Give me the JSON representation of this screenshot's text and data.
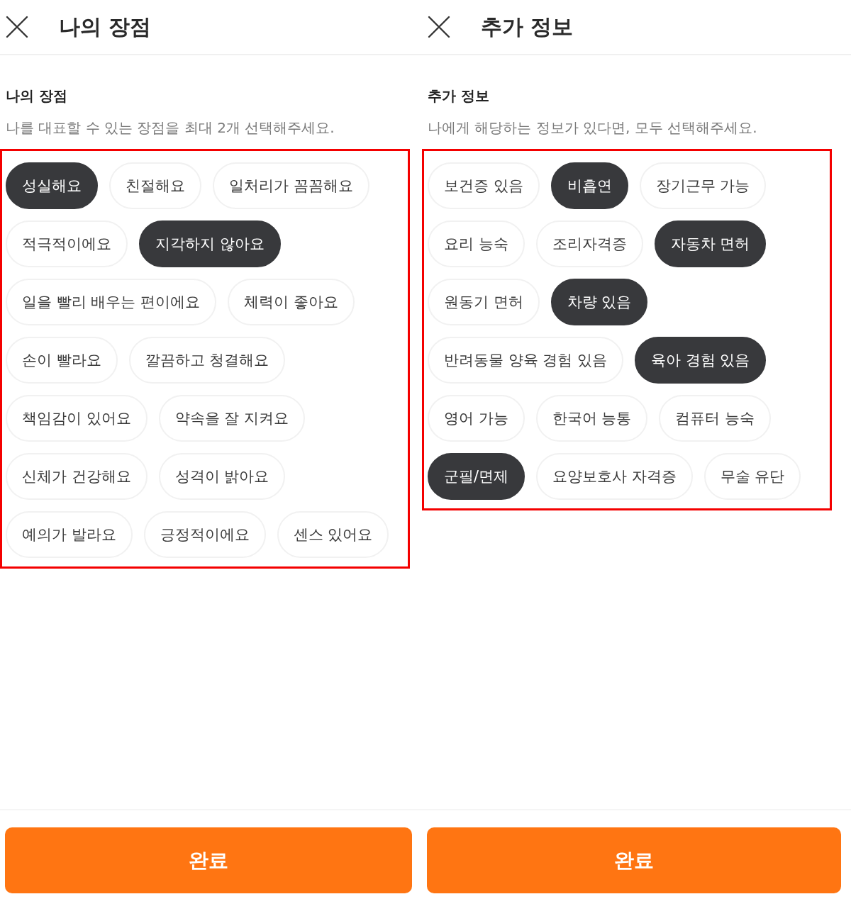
{
  "panels": [
    {
      "header": {
        "title": "나의 장점"
      },
      "section": {
        "title": "나의 장점",
        "description": "나를 대표할 수 있는 장점을 최대 2개 선택해주세요."
      },
      "chips": {
        "highlighted": true,
        "rows": [
          [
            {
              "label": "성실해요",
              "selected": true
            },
            {
              "label": "친절해요",
              "selected": false
            },
            {
              "label": "일처리가 꼼꼼해요",
              "selected": false
            }
          ],
          [
            {
              "label": "적극적이에요",
              "selected": false
            },
            {
              "label": "지각하지 않아요",
              "selected": true
            }
          ],
          [
            {
              "label": "일을 빨리 배우는 편이에요",
              "selected": false
            },
            {
              "label": "체력이 좋아요",
              "selected": false
            }
          ],
          [
            {
              "label": "손이 빨라요",
              "selected": false
            },
            {
              "label": "깔끔하고 청결해요",
              "selected": false
            }
          ],
          [
            {
              "label": "책임감이 있어요",
              "selected": false
            },
            {
              "label": "약속을 잘 지켜요",
              "selected": false
            }
          ],
          [
            {
              "label": "신체가 건강해요",
              "selected": false
            },
            {
              "label": "성격이 밝아요",
              "selected": false
            }
          ],
          [
            {
              "label": "예의가 발라요",
              "selected": false
            },
            {
              "label": "긍정적이에요",
              "selected": false
            },
            {
              "label": "센스 있어요",
              "selected": false
            }
          ]
        ]
      },
      "submit_button": {
        "label": "완료"
      }
    },
    {
      "header": {
        "title": "추가 정보"
      },
      "section": {
        "title": "추가 정보",
        "description": "나에게 해당하는 정보가 있다면, 모두 선택해주세요."
      },
      "chips": {
        "highlighted": true,
        "rows": [
          [
            {
              "label": "보건증 있음",
              "selected": false
            },
            {
              "label": "비흡연",
              "selected": true
            },
            {
              "label": "장기근무 가능",
              "selected": false
            }
          ],
          [
            {
              "label": "요리 능숙",
              "selected": false
            },
            {
              "label": "조리자격증",
              "selected": false
            },
            {
              "label": "자동차 면허",
              "selected": true
            }
          ],
          [
            {
              "label": "원동기 면허",
              "selected": false
            },
            {
              "label": "차량 있음",
              "selected": true
            }
          ],
          [
            {
              "label": "반려동물 양육 경험 있음",
              "selected": false
            },
            {
              "label": "육아 경험 있음",
              "selected": true
            }
          ],
          [
            {
              "label": "영어 가능",
              "selected": false
            },
            {
              "label": "한국어 능통",
              "selected": false
            },
            {
              "label": "컴퓨터 능숙",
              "selected": false
            }
          ],
          [
            {
              "label": "군필/면제",
              "selected": true
            },
            {
              "label": "요양보호사 자격증",
              "selected": false
            },
            {
              "label": "무술 유단",
              "selected": false
            }
          ]
        ]
      },
      "submit_button": {
        "label": "완료"
      }
    }
  ]
}
